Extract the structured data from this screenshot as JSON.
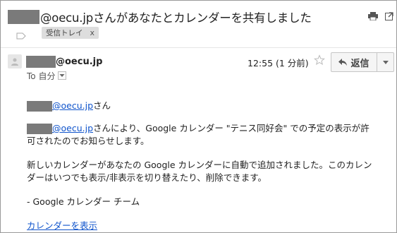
{
  "email": {
    "subject": "@oecu.jpさんがあなたとカレンダーを共有しました",
    "label_chip": "受信トレイ",
    "label_chip_close": "x",
    "sender": "@oecu.jp",
    "to_text": "To 自分",
    "time": "12:55 (1 分前)",
    "reply_label": "返信"
  },
  "body": {
    "greeting_link": "@oecu.jp",
    "greeting_suffix": "さん",
    "p1_link": "@oecu.jp",
    "p1_line1_suffix": "さんにより、Google カレンダー \"テニス同好会\" での予定の表示が許",
    "p1_line2": "可されたのでお知らせします。",
    "p2_line1": "新しいカレンダーがあなたの Google カレンダーに自動で追加されました。このカレン",
    "p2_line2": "ダーはいつでも表示/非表示を切り替えたり、削除できます。",
    "signature": "- Google カレンダー チーム",
    "view_link": "カレンダーを表示"
  },
  "icons": {
    "print": "print-icon",
    "new_window": "new-window-icon",
    "label": "label-icon",
    "avatar": "person-icon",
    "star": "star-icon",
    "reply": "reply-icon",
    "more": "chevron-down-icon"
  }
}
